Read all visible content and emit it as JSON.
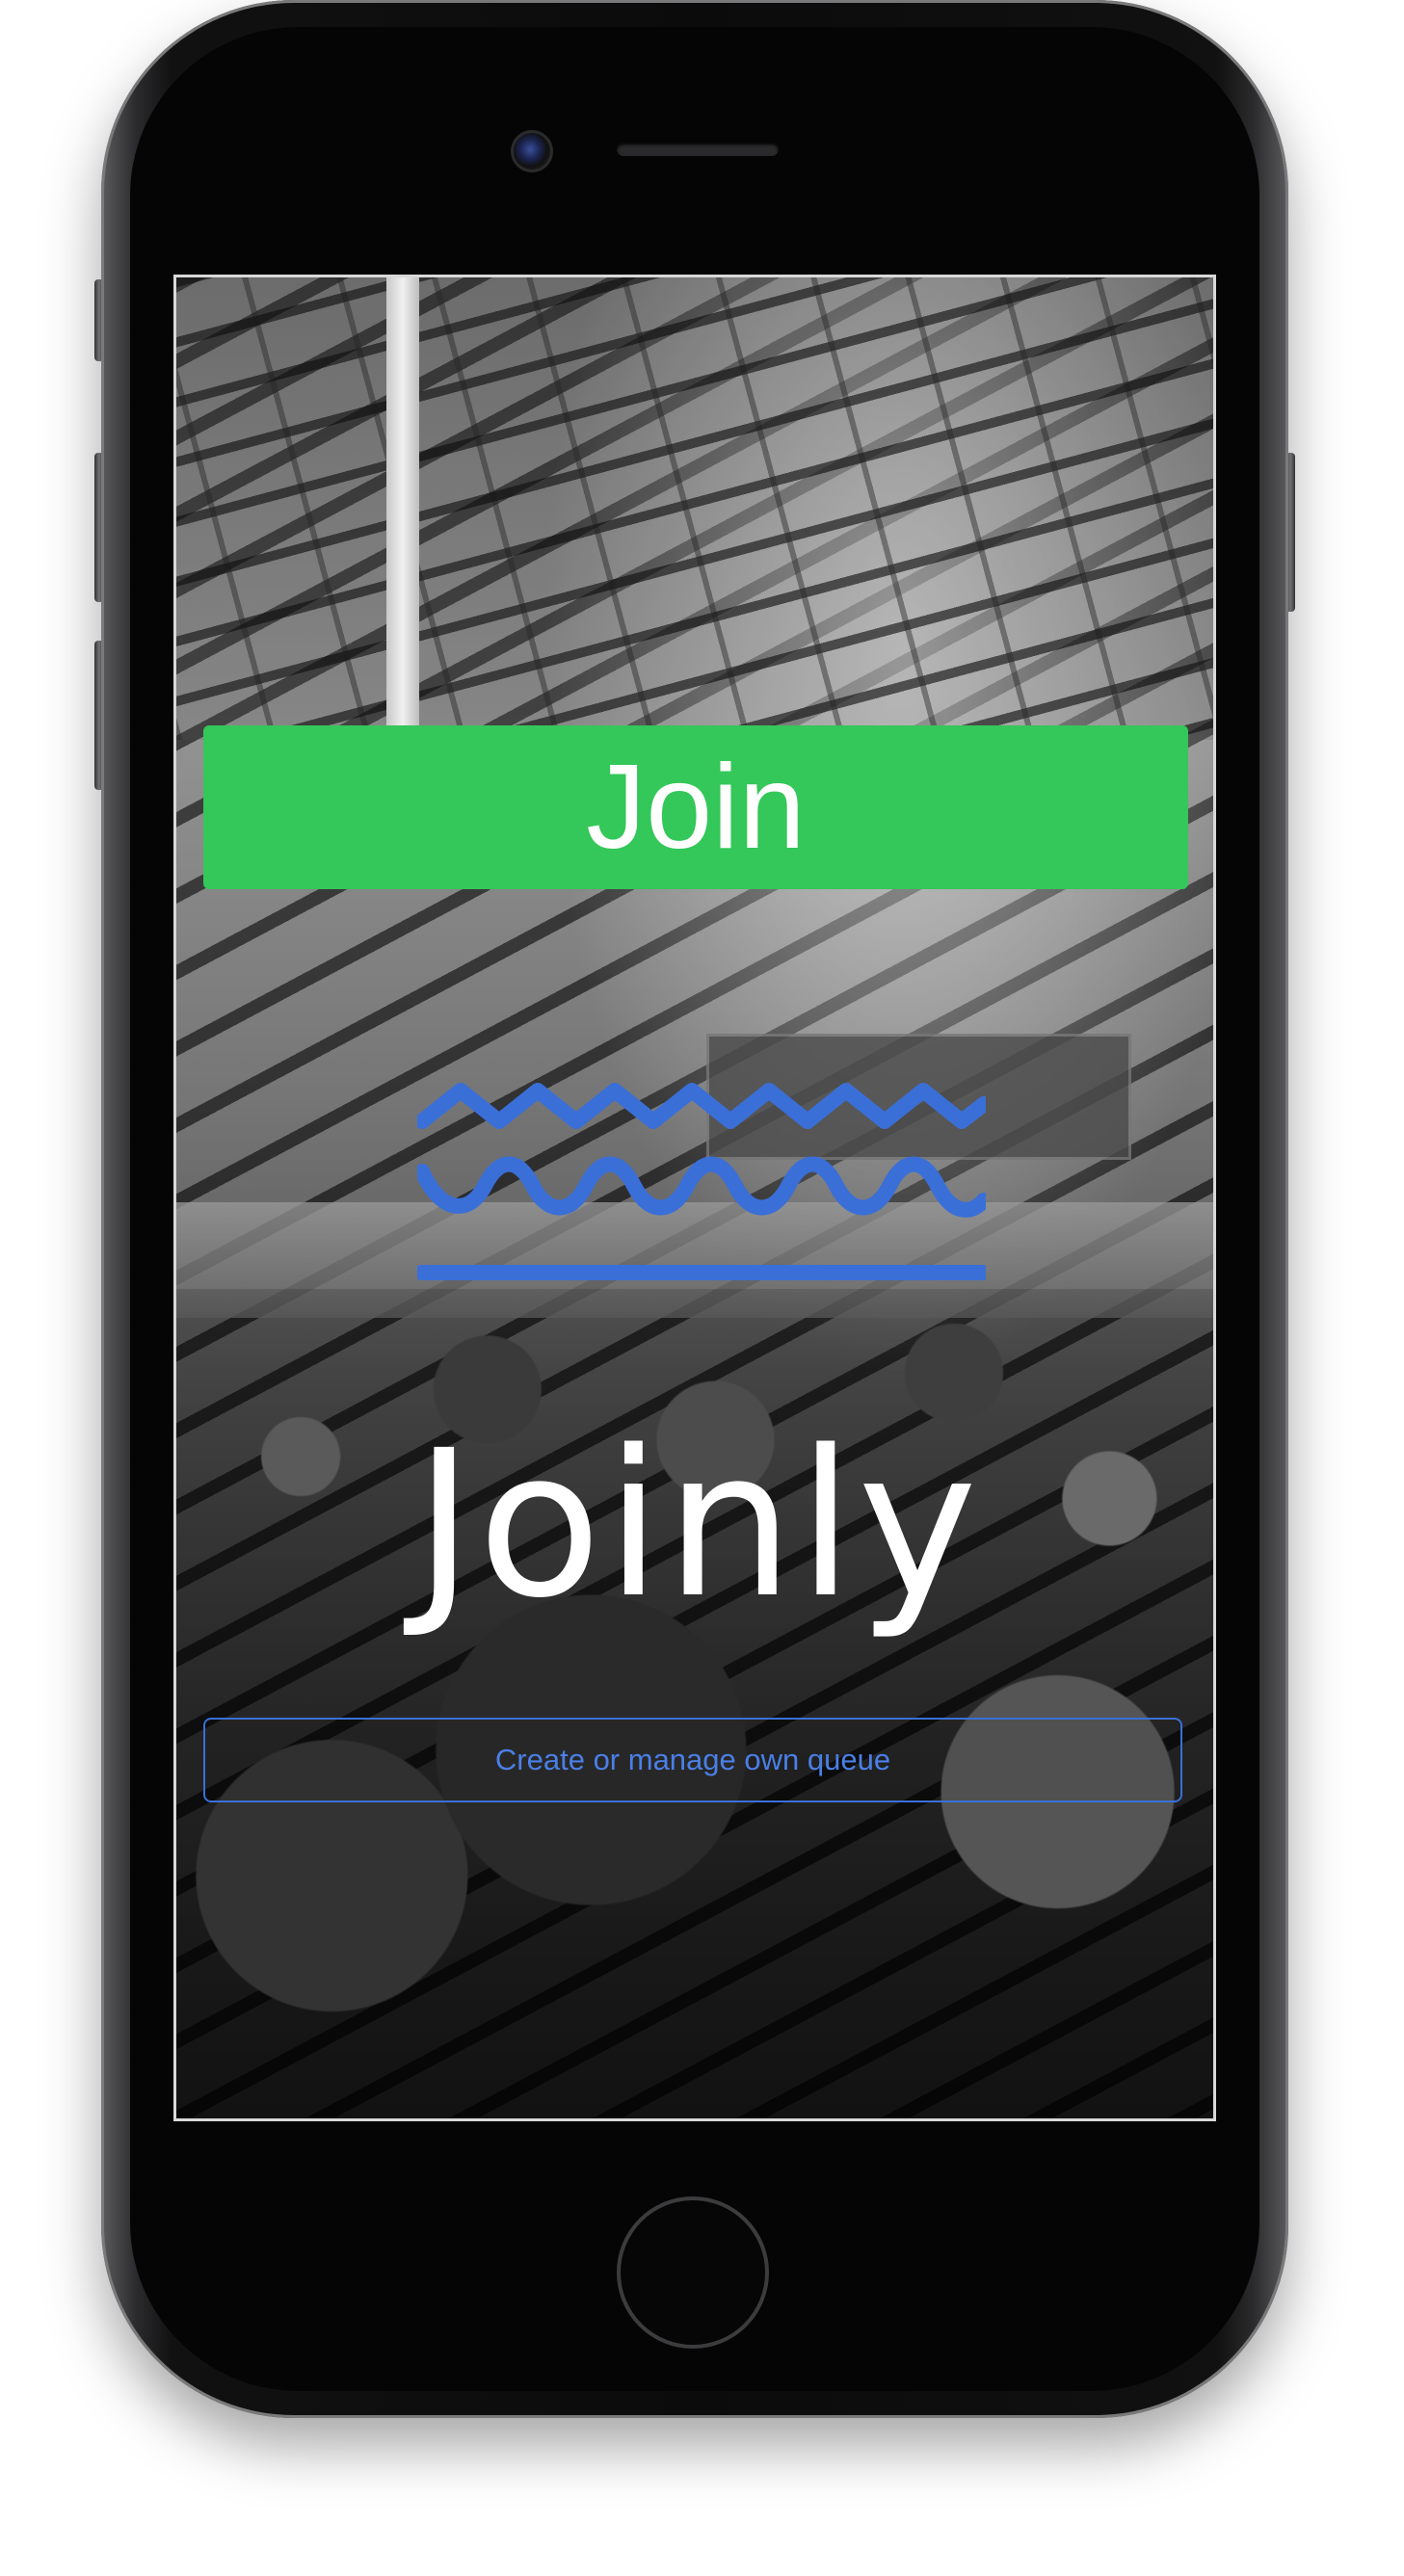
{
  "app": {
    "join_label": "Join",
    "brand_name": "Joinly",
    "manage_label": "Create or manage own queue"
  },
  "colors": {
    "join_button": "#34c759",
    "accent_blue": "#3a6fd8",
    "brand_text": "#ffffff"
  },
  "icons": {
    "logo": "joinly-waves-logo"
  }
}
